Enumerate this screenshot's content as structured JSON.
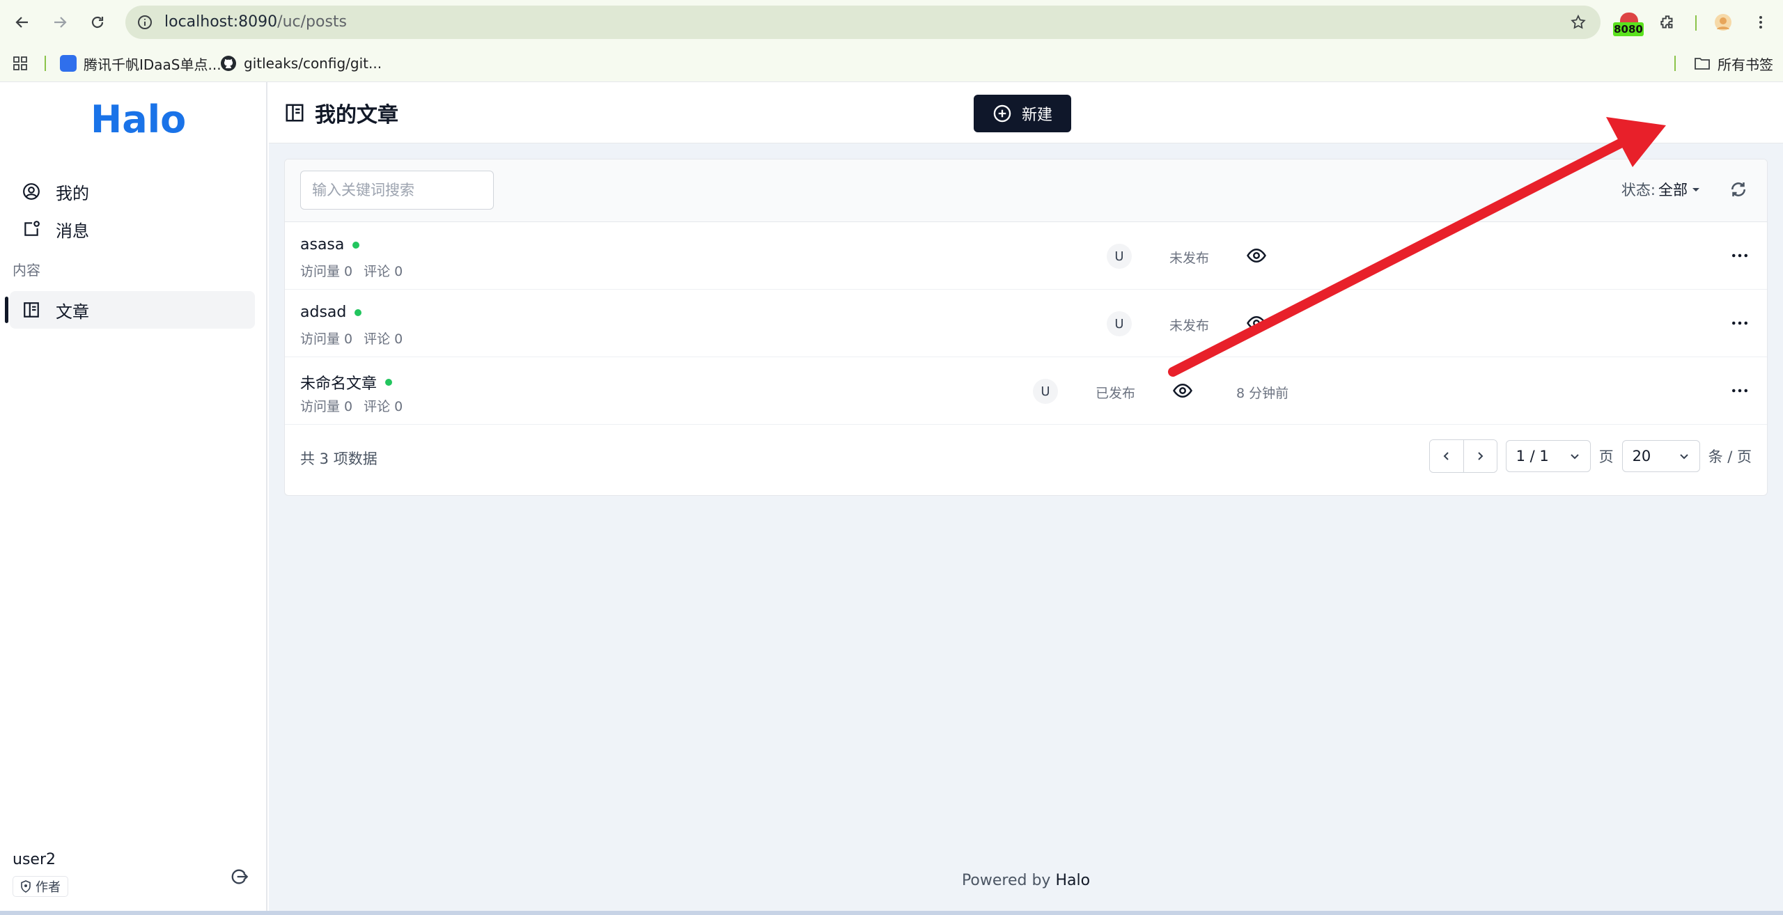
{
  "browser": {
    "url_host": "localhost:8090",
    "url_path": "/uc/posts",
    "extension_badge": "8080",
    "bookmarks": [
      {
        "label": "腾讯千帆IDaaS单点..."
      },
      {
        "label": "gitleaks/config/git..."
      }
    ],
    "all_bookmarks": "所有书签"
  },
  "sidebar": {
    "logo": "Halo",
    "items": [
      {
        "label": "我的"
      },
      {
        "label": "消息"
      }
    ],
    "group_label": "内容",
    "content_items": [
      {
        "label": "文章"
      }
    ],
    "user": {
      "name": "user2",
      "role": "作者"
    }
  },
  "header": {
    "title": "我的文章",
    "new_button": "新建"
  },
  "filters": {
    "search_placeholder": "输入关键词搜索",
    "status_label": "状态:",
    "status_value": "全部"
  },
  "posts": [
    {
      "title": "asasa",
      "views": "访问量 0",
      "comments": "评论 0",
      "author": "U",
      "state": "未发布",
      "time": ""
    },
    {
      "title": "adsad",
      "views": "访问量 0",
      "comments": "评论 0",
      "author": "U",
      "state": "未发布",
      "time": ""
    },
    {
      "title": "未命名文章",
      "views": "访问量 0",
      "comments": "评论 0",
      "author": "U",
      "state": "已发布",
      "time": "8 分钟前"
    }
  ],
  "pagination": {
    "total": "共 3 项数据",
    "page": "1 / 1",
    "page_unit": "页",
    "size": "20",
    "size_unit": "条 / 页"
  },
  "footer": {
    "prefix": "Powered by",
    "brand": "Halo"
  },
  "colors": {
    "accent": "#0f172a",
    "published_dot": "#22c55e",
    "annotation_arrow": "#e8202a",
    "logo_blue": "#1a73e8"
  }
}
